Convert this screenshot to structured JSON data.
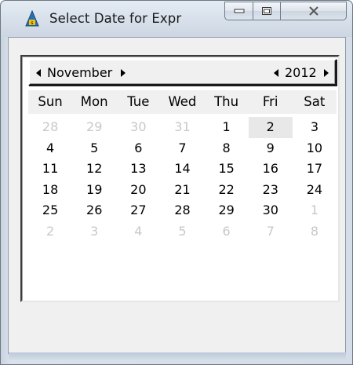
{
  "window": {
    "title": "Select Date for Expr"
  },
  "calendar": {
    "month_label": "November",
    "year_label": "2012",
    "weekdays": [
      "Sun",
      "Mon",
      "Tue",
      "Wed",
      "Thu",
      "Fri",
      "Sat"
    ],
    "rows": [
      [
        {
          "d": "28",
          "m": true
        },
        {
          "d": "29",
          "m": true
        },
        {
          "d": "30",
          "m": true
        },
        {
          "d": "31",
          "m": true
        },
        {
          "d": "1",
          "m": false
        },
        {
          "d": "2",
          "m": false,
          "today": true
        },
        {
          "d": "3",
          "m": false
        }
      ],
      [
        {
          "d": "4"
        },
        {
          "d": "5"
        },
        {
          "d": "6"
        },
        {
          "d": "7"
        },
        {
          "d": "8"
        },
        {
          "d": "9"
        },
        {
          "d": "10"
        }
      ],
      [
        {
          "d": "11"
        },
        {
          "d": "12"
        },
        {
          "d": "13"
        },
        {
          "d": "14"
        },
        {
          "d": "15"
        },
        {
          "d": "16"
        },
        {
          "d": "17"
        }
      ],
      [
        {
          "d": "18"
        },
        {
          "d": "19"
        },
        {
          "d": "20"
        },
        {
          "d": "21"
        },
        {
          "d": "22"
        },
        {
          "d": "23"
        },
        {
          "d": "24"
        }
      ],
      [
        {
          "d": "25"
        },
        {
          "d": "26"
        },
        {
          "d": "27"
        },
        {
          "d": "28"
        },
        {
          "d": "29"
        },
        {
          "d": "30"
        },
        {
          "d": "1",
          "m": true
        }
      ],
      [
        {
          "d": "2",
          "m": true
        },
        {
          "d": "3",
          "m": true
        },
        {
          "d": "4",
          "m": true
        },
        {
          "d": "5",
          "m": true
        },
        {
          "d": "6",
          "m": true
        },
        {
          "d": "7",
          "m": true
        },
        {
          "d": "8",
          "m": true
        }
      ]
    ]
  },
  "icons": {
    "app": "app-logo-icon",
    "minimize": "minimize-icon",
    "maximize": "maximize-icon",
    "close": "close-icon",
    "prev_month": "chevron-left-icon",
    "next_month": "chevron-right-icon",
    "prev_year": "chevron-left-icon",
    "next_year": "chevron-right-icon"
  },
  "colors": {
    "muted_day": "#c8c8c8",
    "today_bg": "#e8e8e8",
    "app_icon": "#2a6fb3"
  }
}
